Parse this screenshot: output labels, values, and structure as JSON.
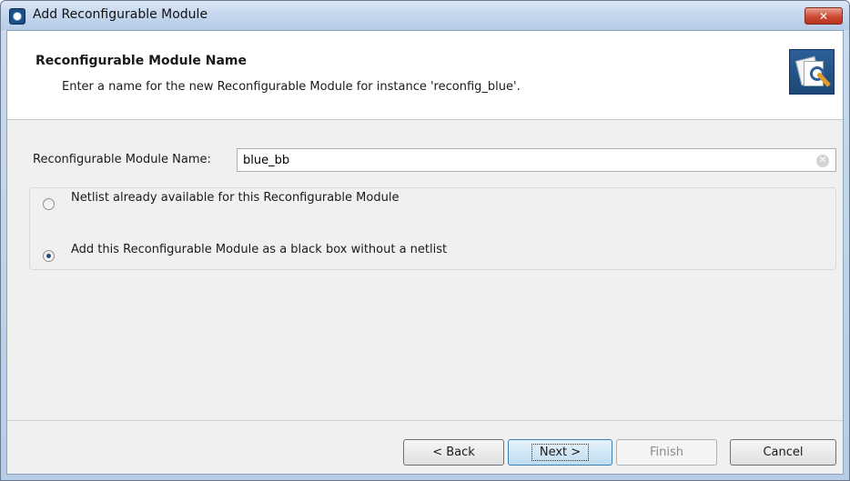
{
  "window": {
    "title": "Add Reconfigurable Module",
    "close_label": "✕"
  },
  "header": {
    "title": "Reconfigurable Module Name",
    "description": "Enter a name for the new Reconfigurable Module for instance 'reconfig_blue'."
  },
  "form": {
    "name_label": "Reconfigurable Module Name:",
    "name_value": "blue_bb"
  },
  "options": [
    {
      "label": "Netlist already available for this Reconfigurable Module",
      "checked": false
    },
    {
      "label": "Add this Reconfigurable Module as a black box without a netlist",
      "checked": true
    }
  ],
  "buttons": {
    "back": "< Back",
    "next": "Next >",
    "finish": "Finish",
    "cancel": "Cancel"
  }
}
